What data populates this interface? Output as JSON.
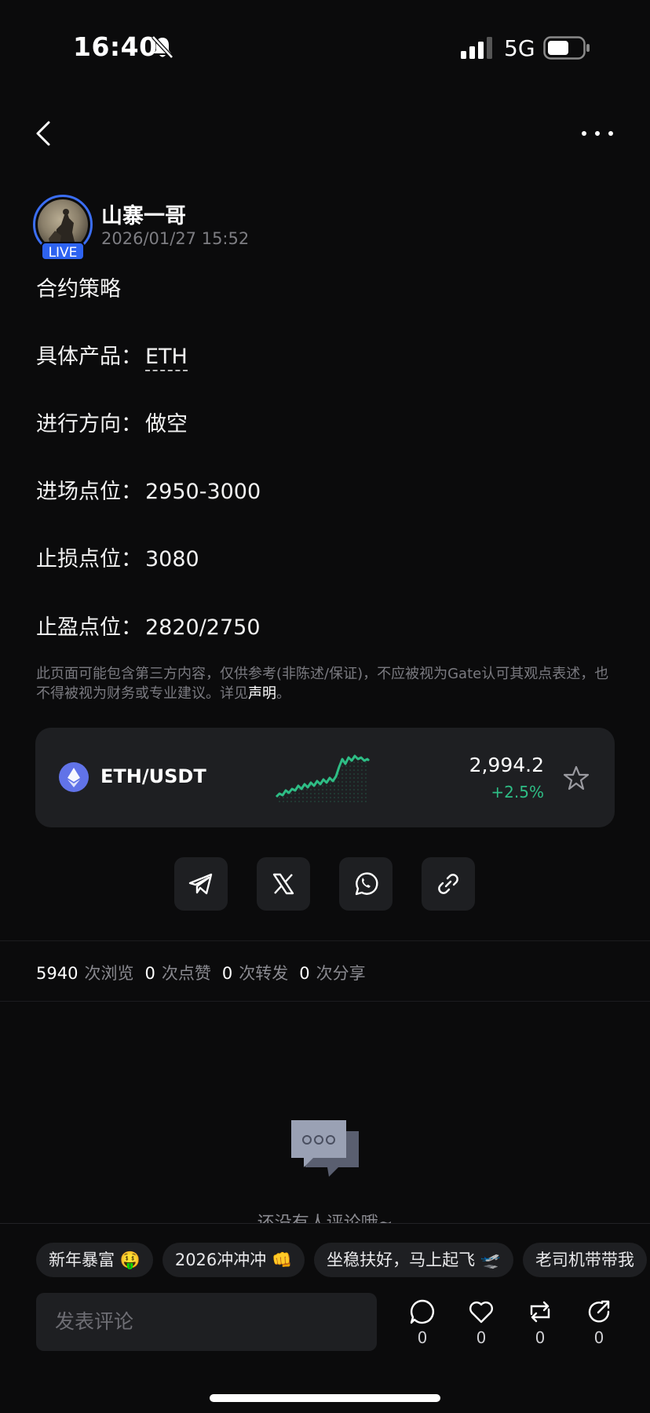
{
  "status_bar": {
    "time": "16:40",
    "network": "5G"
  },
  "author": {
    "name": "山寨一哥",
    "timestamp": "2026/01/27 15:52",
    "badge": "LIVE"
  },
  "post": {
    "title": "合约策略",
    "lines": [
      {
        "label": "具体产品：",
        "value": "ETH"
      },
      {
        "label": "进行方向：",
        "value": "做空"
      },
      {
        "label": "进场点位：",
        "value": "2950-3000"
      },
      {
        "label": "止损点位：",
        "value": "3080"
      },
      {
        "label": "止盈点位：",
        "value": "2820/2750"
      }
    ]
  },
  "disclaimer": {
    "text": "此页面可能包含第三方内容，仅供参考(非陈述/保证)，不应被视为Gate认可其观点表述，也不得被视为财务或专业建议。详见",
    "link": "声明",
    "end": "。"
  },
  "ticker": {
    "pair": "ETH/USDT",
    "price": "2,994.2",
    "change": "+2.5%",
    "change_color": "#2ebd85"
  },
  "stats": [
    {
      "count": "5940",
      "label": "次浏览"
    },
    {
      "count": "0",
      "label": "次点赞"
    },
    {
      "count": "0",
      "label": "次转发"
    },
    {
      "count": "0",
      "label": "次分享"
    }
  ],
  "empty_comments": "还没有人评论哦~",
  "chips": [
    "新年暴富 🤑",
    "2026冲冲冲 👊",
    "坐稳扶好，马上起飞 🛫",
    "老司机带带我"
  ],
  "comment_placeholder": "发表评论",
  "actions": [
    {
      "icon": "comment-icon",
      "count": "0"
    },
    {
      "icon": "heart-icon",
      "count": "0"
    },
    {
      "icon": "repost-icon",
      "count": "0"
    },
    {
      "icon": "share-icon",
      "count": "0"
    }
  ],
  "share_targets": [
    "telegram-icon",
    "x-icon",
    "whatsapp-icon",
    "link-icon"
  ],
  "colors": {
    "accent": "#2e63f0",
    "positive": "#2ebd85",
    "background": "#0b0b0c",
    "card": "#1e1f22"
  }
}
